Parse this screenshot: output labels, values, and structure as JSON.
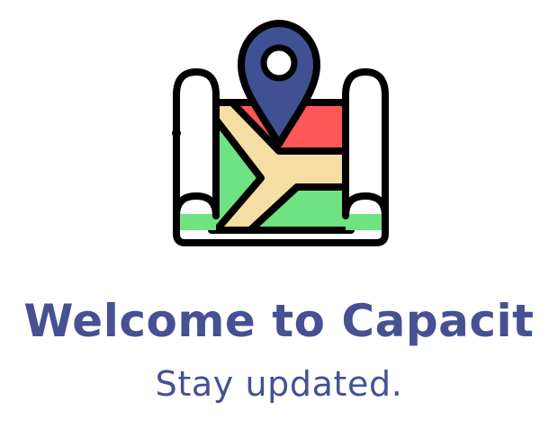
{
  "onboarding": {
    "title": "Welcome to Capacit",
    "subtitle": "Stay updated.",
    "illustration_icon": "map-location-pin-icon"
  },
  "colors": {
    "text": "#455193",
    "outline": "#000000",
    "pin": "#3F5193",
    "map_red": "#FF5757",
    "map_green": "#6FE381",
    "map_road": "#F5DEA3",
    "paper": "#FFFFFF"
  }
}
